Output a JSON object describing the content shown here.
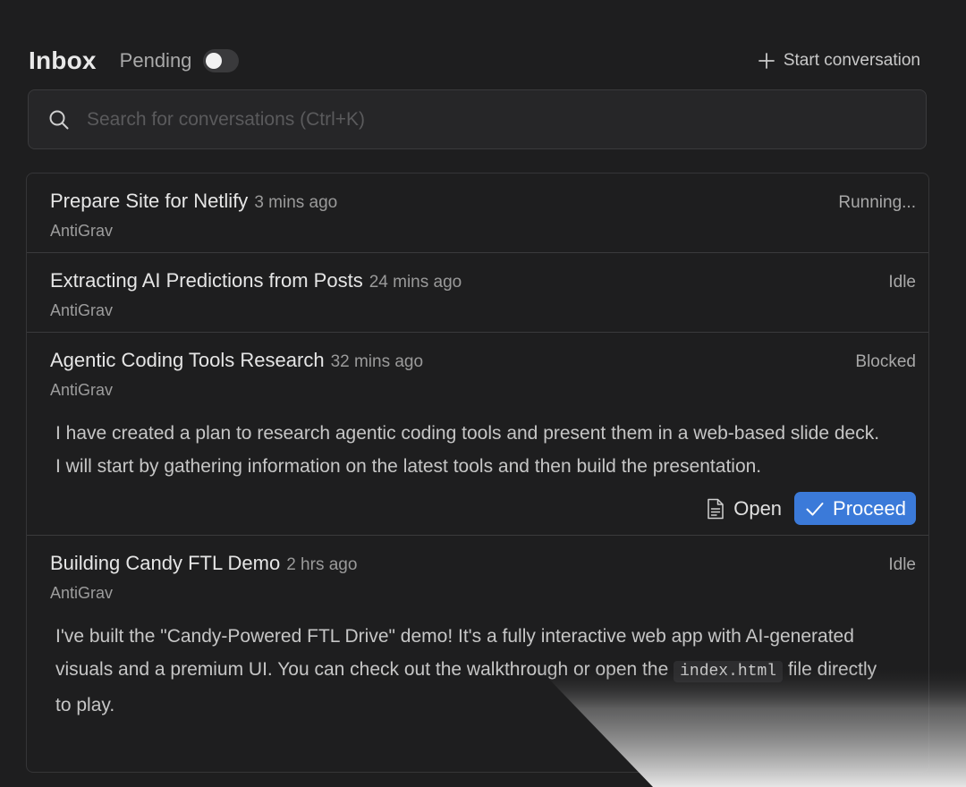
{
  "header": {
    "title": "Inbox",
    "pending_label": "Pending",
    "start_label": "Start conversation"
  },
  "search": {
    "placeholder": "Search for conversations (Ctrl+K)"
  },
  "conversations": [
    {
      "title": "Prepare Site for Netlify",
      "time": "3 mins ago",
      "status": "Running...",
      "author": "AntiGrav"
    },
    {
      "title": "Extracting AI Predictions from Posts",
      "time": "24 mins ago",
      "status": "Idle",
      "author": "AntiGrav"
    },
    {
      "title": "Agentic Coding Tools Research",
      "time": "32 mins ago",
      "status": "Blocked",
      "author": "AntiGrav",
      "body": "I have created a plan to research agentic coding tools and present them in a web-based slide deck. I will start by gathering information on the latest tools and then build the presentation.",
      "open_label": "Open",
      "proceed_label": "Proceed"
    },
    {
      "title": "Building Candy FTL Demo",
      "time": "2 hrs ago",
      "status": "Idle",
      "author": "AntiGrav",
      "body_before": "I've built the \"Candy-Powered FTL Drive\" demo! It's a fully interactive web app with AI-generated visuals and a premium UI. You can check out the walkthrough or open the ",
      "body_code": "index.html",
      "body_after": " file directly to play."
    }
  ],
  "colors": {
    "background": "#1e1e1f",
    "accent": "#3b7ad9"
  }
}
